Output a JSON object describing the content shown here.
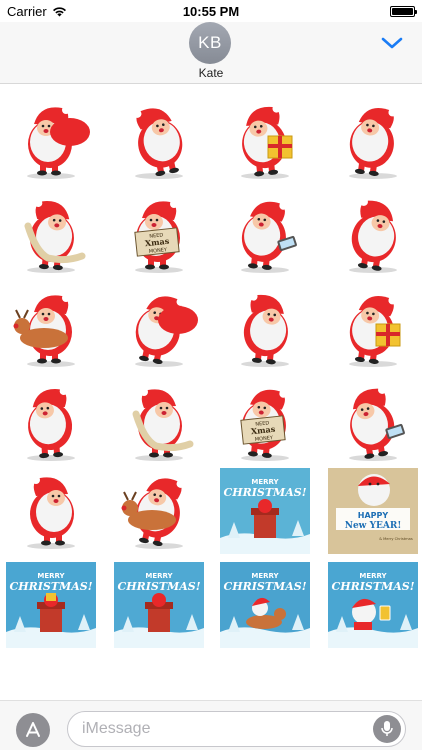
{
  "status_bar": {
    "carrier": "Carrier",
    "time": "10:55 PM",
    "battery_level": 1.0
  },
  "header": {
    "avatar_initials": "KB",
    "contact_name": "Kate",
    "expand_icon": "chevron-down-icon"
  },
  "stickers": [
    {
      "name": "santa-carrying-sack",
      "kind": "character"
    },
    {
      "name": "santa-running",
      "kind": "character"
    },
    {
      "name": "santa-holding-gift",
      "kind": "character"
    },
    {
      "name": "santa-waving",
      "kind": "character"
    },
    {
      "name": "santa-reading-scroll",
      "kind": "character"
    },
    {
      "name": "santa-need-xmas-money-sign",
      "kind": "character",
      "sign_lines": [
        "NEED",
        "Xmas",
        "MONEY"
      ]
    },
    {
      "name": "santa-with-phone",
      "kind": "character"
    },
    {
      "name": "santa-pointing",
      "kind": "character"
    },
    {
      "name": "santa-riding-reindeer",
      "kind": "character"
    },
    {
      "name": "santa-pulling-sack",
      "kind": "character"
    },
    {
      "name": "santa-jumping",
      "kind": "character"
    },
    {
      "name": "santa-with-big-gift",
      "kind": "character"
    },
    {
      "name": "santa-arm-raised",
      "kind": "character"
    },
    {
      "name": "santa-long-list",
      "kind": "character"
    },
    {
      "name": "santa-need-xmas-money-sign-2",
      "kind": "character",
      "sign_lines": [
        "NEED",
        "Xmas",
        "MONEY"
      ]
    },
    {
      "name": "santa-with-phone-2",
      "kind": "character"
    },
    {
      "name": "santa-thumbs-up",
      "kind": "character"
    },
    {
      "name": "santa-on-reindeer-2",
      "kind": "character"
    },
    {
      "name": "merry-christmas-chimney-card",
      "kind": "card",
      "lines": [
        "MERRY",
        "CHRISTMAS!"
      ],
      "bg": "#5bb3d6"
    },
    {
      "name": "happy-new-year-card",
      "kind": "card",
      "lines": [
        "HAPPY",
        "New YEAR!",
        "& Merry Christmas"
      ],
      "bg": "#d8c49a"
    },
    {
      "name": "merry-christmas-gift-chimney-card",
      "kind": "card",
      "lines": [
        "MERRY",
        "CHRISTMAS!"
      ],
      "bg": "#4aa6d2"
    },
    {
      "name": "merry-christmas-chimney-card-2",
      "kind": "card",
      "lines": [
        "MERRY",
        "CHRISTMAS!"
      ],
      "bg": "#4fa9d3"
    },
    {
      "name": "merry-christmas-reindeer-card",
      "kind": "card",
      "lines": [
        "MERRY",
        "CHRISTMAS!"
      ],
      "bg": "#4aa3cf"
    },
    {
      "name": "merry-christmas-beer-card",
      "kind": "card",
      "lines": [
        "MERRY",
        "CHRISTMAS!"
      ],
      "bg": "#4aa6d2"
    }
  ],
  "input_bar": {
    "apps_icon": "app-store-icon",
    "placeholder": "iMessage",
    "mic_icon": "microphone-icon"
  }
}
